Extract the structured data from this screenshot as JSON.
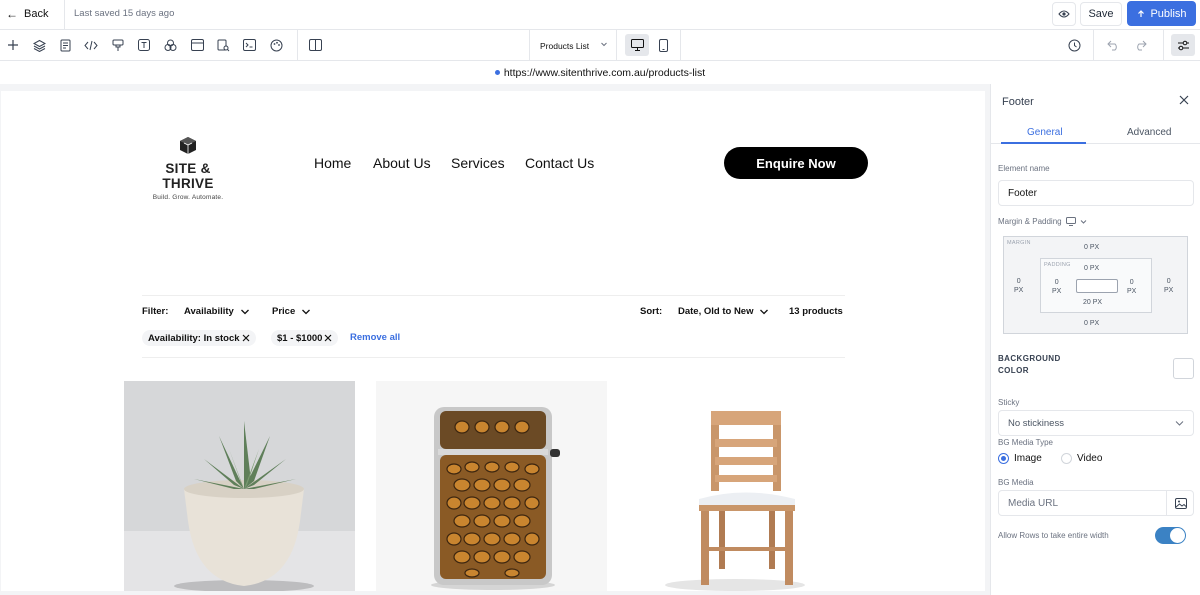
{
  "topbar": {
    "back_label": "Back",
    "saved_status": "Last saved 15 days ago",
    "save_label": "Save",
    "publish_label": "Publish"
  },
  "toolbar": {
    "page_selector": "Products List",
    "icons": [
      "plus-icon",
      "layers-icon",
      "pages-icon",
      "code-icon",
      "brush-icon",
      "text-icon",
      "elements-icon",
      "browser-icon",
      "search-doc-icon",
      "terminal-icon",
      "palette-icon",
      "split-view-icon"
    ]
  },
  "url": "https://www.sitenthrive.com.au/products-list",
  "site": {
    "logo_name": "SITE & THRIVE",
    "logo_tagline": "Build. Grow. Automate.",
    "nav": [
      "Home",
      "About Us",
      "Services",
      "Contact Us"
    ],
    "cta": "Enquire Now",
    "filter_label": "Filter:",
    "filter_availability": "Availability",
    "filter_price": "Price",
    "sort_label": "Sort:",
    "sort_value": "Date, Old to New",
    "product_count": "13 products",
    "chips": [
      "Availability: In stock",
      "$1 - $1000"
    ],
    "remove_all": "Remove all"
  },
  "panel": {
    "title": "Footer",
    "tab_general": "General",
    "tab_advanced": "Advanced",
    "element_name_label": "Element name",
    "element_name_value": "Footer",
    "margin_padding_label": "Margin & Padding",
    "margin_label": "MARGIN",
    "padding_label": "PADDING",
    "margin_top": "0 PX",
    "margin_bottom": "0 PX",
    "margin_left_val": "0",
    "margin_left_unit": "PX",
    "margin_right_val": "0",
    "margin_right_unit": "PX",
    "padding_top": "0 PX",
    "padding_bottom": "20 PX",
    "padding_left_val": "0",
    "padding_left_unit": "PX",
    "padding_right_val": "0",
    "padding_right_unit": "PX",
    "bg_color_label_1": "BACKGROUND",
    "bg_color_label_2": "COLOR",
    "sticky_label": "Sticky",
    "sticky_value": "No stickiness",
    "bg_media_type_label": "BG Media Type",
    "bg_media_image": "Image",
    "bg_media_video": "Video",
    "bg_media_label": "BG Media",
    "media_url_placeholder": "Media URL",
    "allow_rows_label": "Allow Rows to take entire width"
  },
  "colors": {
    "accent": "#3b6fe0",
    "toggle_on": "#3b82c4"
  }
}
